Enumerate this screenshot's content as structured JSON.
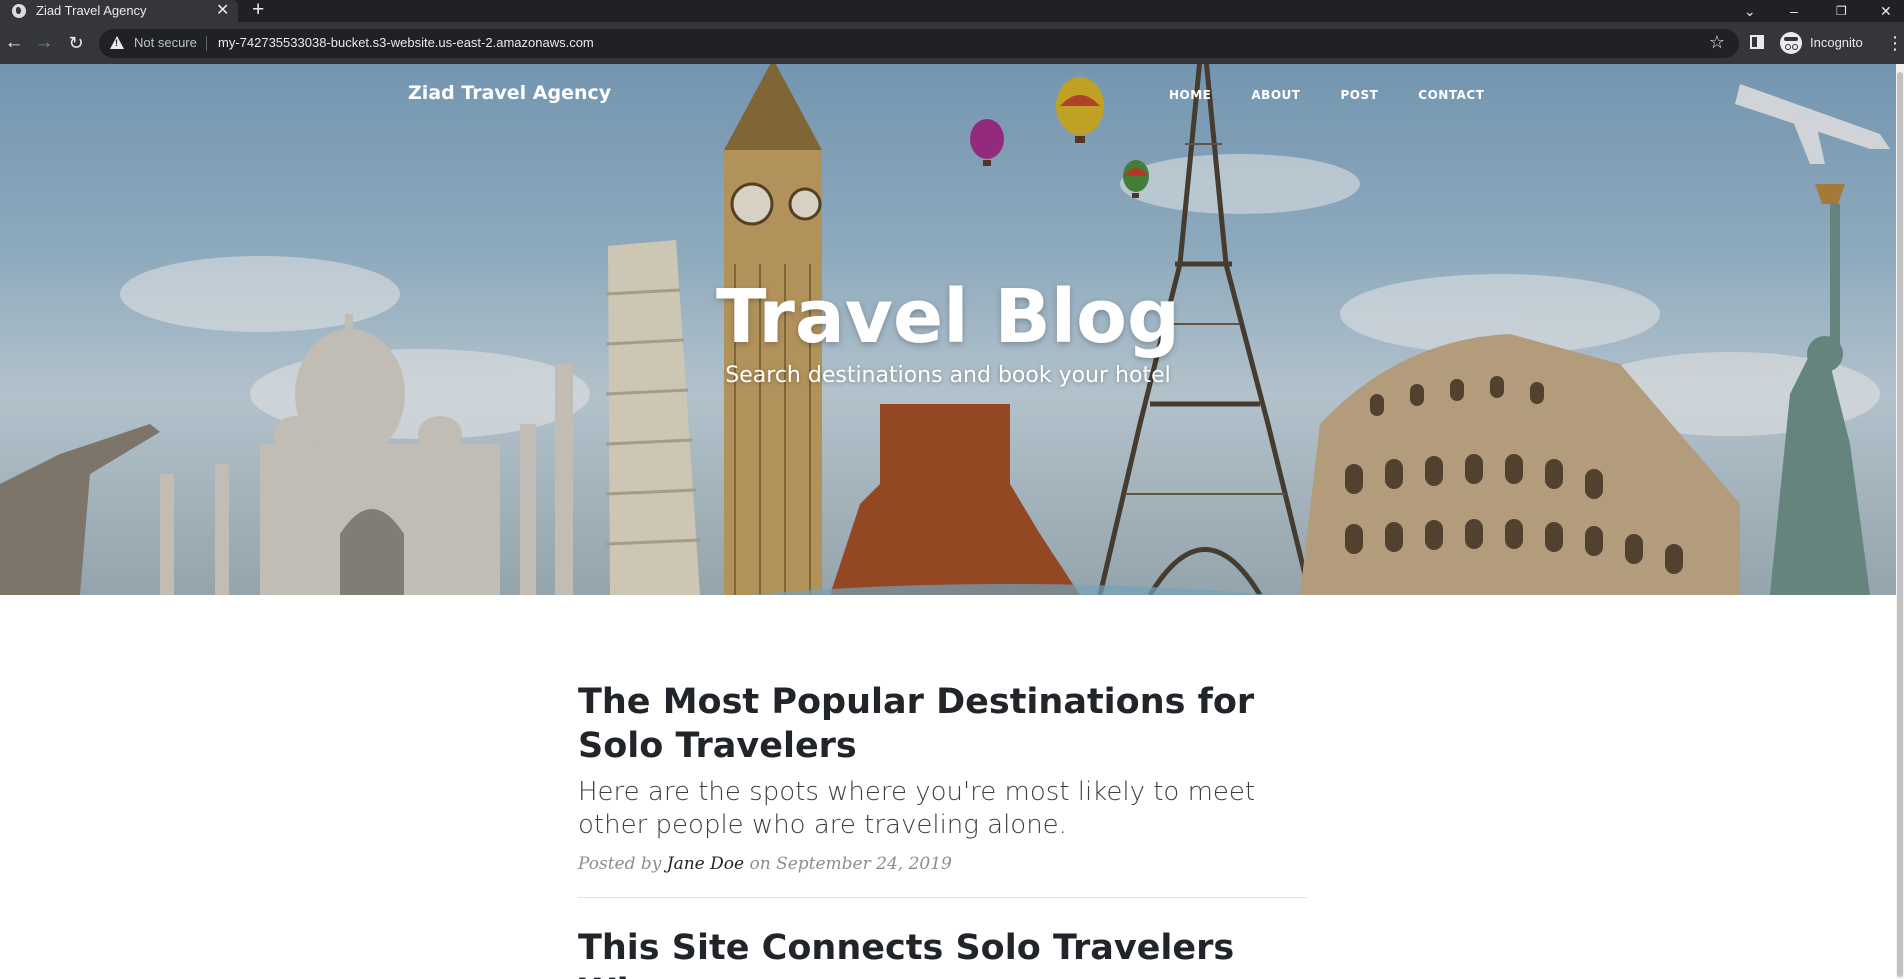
{
  "browser": {
    "tab_title": "Ziad Travel Agency",
    "new_tab_symbol": "+",
    "not_secure": "Not secure",
    "url": "my-742735533038-bucket.s3-website.us-east-2.amazonaws.com",
    "profile_label": "Incognito"
  },
  "site": {
    "brand": "Ziad Travel Agency",
    "nav": [
      "HOME",
      "ABOUT",
      "POST",
      "CONTACT"
    ],
    "hero_title": "Travel Blog",
    "hero_subtitle": "Search destinations and book your hotel"
  },
  "posts": [
    {
      "title": "The Most Popular Destinations for Solo Travelers",
      "subtitle": "Here are the spots where you're most likely to meet other people who are traveling alone.",
      "meta_prefix": "Posted by",
      "author": "Jane Doe",
      "meta_on": "on",
      "date": "September 24, 2019"
    },
    {
      "title": "This Site Connects Solo Travelers Who"
    }
  ]
}
